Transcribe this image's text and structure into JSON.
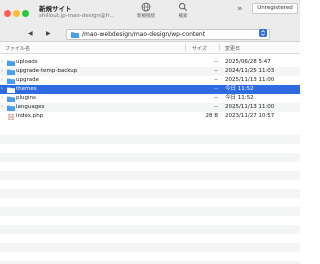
{
  "window": {
    "title": "新規サイト",
    "subtitle": "shillout.jp-mao-design@fr..."
  },
  "toolbar": {
    "connect_label": "新規接続",
    "search_label": "検索",
    "overflow": "»",
    "unregistered_label": "Unregistered"
  },
  "pathbar": {
    "path": "/mao-webdesign/mao-design/wp-content",
    "back": "◀",
    "forward": "▶"
  },
  "columns": {
    "name": "ファイル名",
    "size": "サイズ",
    "modified": "変更日"
  },
  "files": [
    {
      "name": "uploads",
      "size": "--",
      "modified": "2025/06/28 5:47",
      "type": "folder",
      "selected": false
    },
    {
      "name": "upgrade-temp-backup",
      "size": "--",
      "modified": "2024/11/25 11:03",
      "type": "folder",
      "selected": false
    },
    {
      "name": "upgrade",
      "size": "--",
      "modified": "2025/11/13 11:00",
      "type": "folder",
      "selected": false
    },
    {
      "name": "themes",
      "size": "--",
      "modified": "今日 11:52",
      "type": "folder",
      "selected": true
    },
    {
      "name": "plugins",
      "size": "--",
      "modified": "今日 11:52",
      "type": "folder",
      "selected": false
    },
    {
      "name": "languages",
      "size": "--",
      "modified": "2025/11/13 11:00",
      "type": "folder",
      "selected": false
    },
    {
      "name": "index.php",
      "size": "28 B",
      "modified": "2023/11/27 10:57",
      "type": "php",
      "selected": false
    }
  ],
  "colors": {
    "selection": "#2e6ae0",
    "folder": "#4a9ef0",
    "php_icon": "#c0392b"
  }
}
